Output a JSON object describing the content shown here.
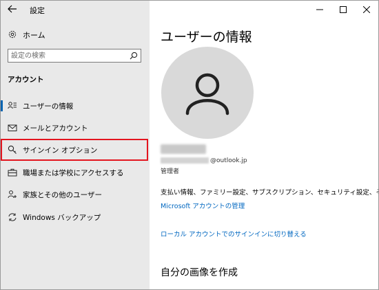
{
  "app": {
    "title": "設定"
  },
  "sidebar": {
    "home_label": "ホーム",
    "search_placeholder": "設定の検索",
    "section_heading": "アカウント",
    "items": [
      {
        "label": "ユーザーの情報",
        "icon": "person-list-icon",
        "active": true
      },
      {
        "label": "メールとアカウント",
        "icon": "mail-icon"
      },
      {
        "label": "サインイン オプション",
        "icon": "key-icon",
        "highlighted": true
      },
      {
        "label": "職場または学校にアクセスする",
        "icon": "briefcase-icon"
      },
      {
        "label": "家族とその他のユーザー",
        "icon": "person-add-icon"
      },
      {
        "label": "Windows バックアップ",
        "icon": "sync-icon"
      }
    ]
  },
  "main": {
    "title": "ユーザーの情報",
    "email_suffix": "@outlook.jp",
    "role": "管理者",
    "summary": "支払い情報、ファミリー設定、サブスクリプション、セキュリティ設定、その他",
    "ms_account_link": "Microsoft アカウントの管理",
    "local_account_link": "ローカル アカウントでのサインインに切り替える",
    "picture_heading": "自分の画像を作成"
  },
  "colors": {
    "accent": "#0063b1",
    "link": "#0067c0",
    "highlight_box": "#e3141e",
    "sidebar_bg": "#e9e9e9"
  }
}
